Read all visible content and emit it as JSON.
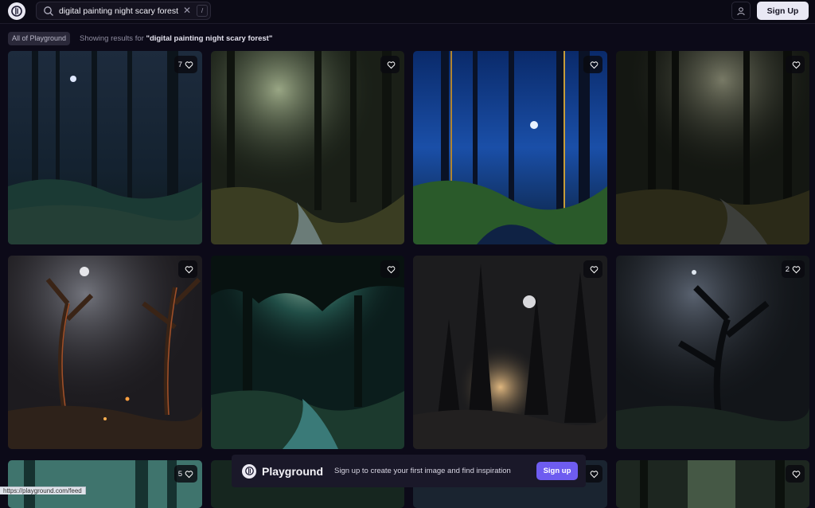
{
  "header": {
    "search_value": "digital painting night scary forest",
    "search_shortcut": "/",
    "signup_label": "Sign Up"
  },
  "filter": {
    "chip_label": "All of Playground",
    "results_prefix": "Showing results for",
    "results_query": "\"digital painting night scary forest\""
  },
  "cards": [
    {
      "likes": "7"
    },
    {
      "likes": ""
    },
    {
      "likes": ""
    },
    {
      "likes": ""
    },
    {
      "likes": ""
    },
    {
      "likes": ""
    },
    {
      "likes": ""
    },
    {
      "likes": "2"
    },
    {
      "likes": "5"
    },
    {
      "likes": ""
    },
    {
      "likes": ""
    },
    {
      "likes": ""
    }
  ],
  "banner": {
    "brand": "Playground",
    "message": "Sign up to create your first image and find inspiration",
    "button_label": "Sign up"
  },
  "status_bar": {
    "url": "https://playground.com/feed"
  },
  "colors": {
    "accent": "#6e5cf0",
    "background": "#0c0a18"
  }
}
